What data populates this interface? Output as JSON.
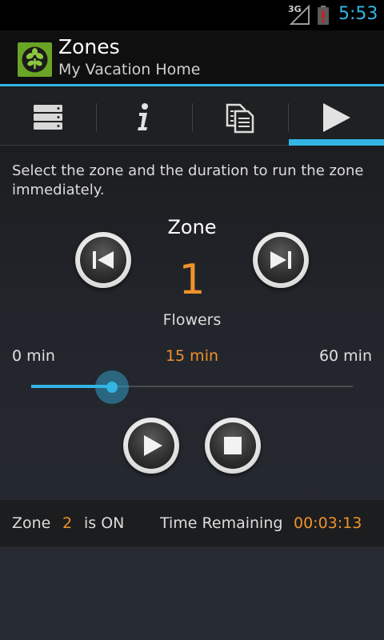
{
  "status_bar": {
    "network": "3G",
    "time": "5:53"
  },
  "action_bar": {
    "title": "Zones",
    "subtitle": "My Vacation Home"
  },
  "tabs": [
    {
      "icon": "server-icon",
      "selected": false
    },
    {
      "icon": "info-icon",
      "selected": false
    },
    {
      "icon": "documents-icon",
      "selected": false
    },
    {
      "icon": "play-tab-icon",
      "selected": true
    }
  ],
  "content": {
    "instructions": "Select the zone and the duration to run the zone immediately.",
    "zone_label": "Zone",
    "zone_number": "1",
    "zone_name": "Flowers",
    "duration": {
      "min_label": "0 min",
      "current_label": "15 min",
      "max_label": "60 min",
      "value_fraction": 0.25
    }
  },
  "status": {
    "zone_word": "Zone",
    "zone_on_number": "2",
    "is_on_text": "is ON",
    "remaining_label": "Time Remaining",
    "remaining_value": "00:03:13"
  },
  "colors": {
    "accent": "#33b5e5",
    "highlight": "#f0922b"
  }
}
